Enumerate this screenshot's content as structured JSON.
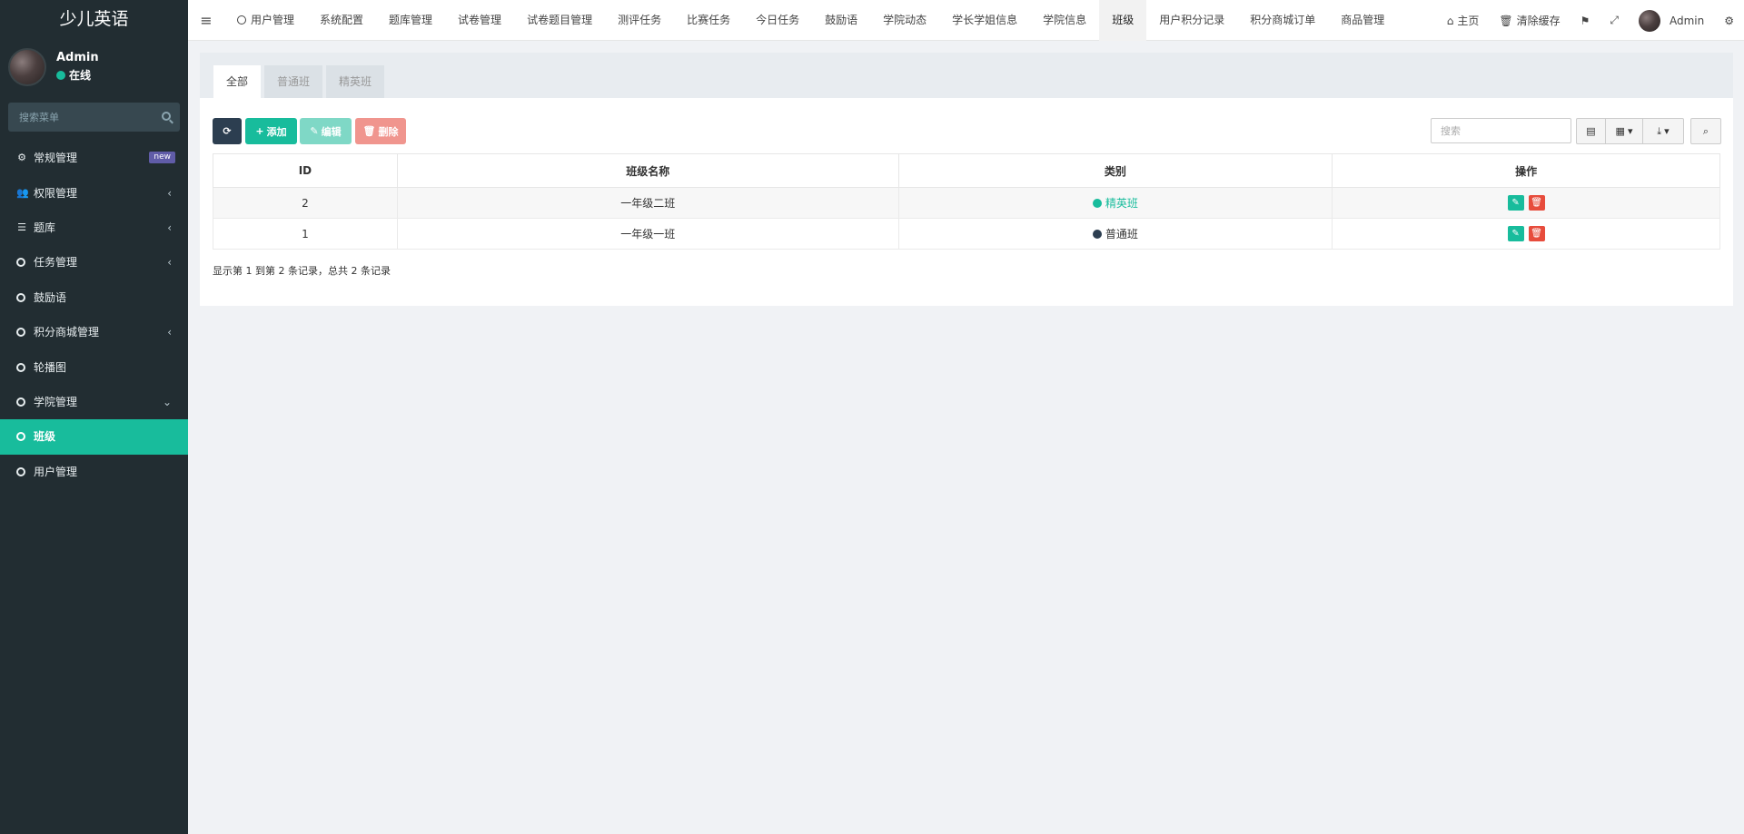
{
  "sidebar": {
    "brand": "少儿英语",
    "user": {
      "name": "Admin",
      "status": "在线"
    },
    "search_placeholder": "搜索菜单",
    "items": [
      {
        "label": "常规管理",
        "icon": "cogs-icon",
        "badge": "new"
      },
      {
        "label": "权限管理",
        "icon": "users-icon",
        "arrow": "‹"
      },
      {
        "label": "题库",
        "icon": "list-icon",
        "arrow": "‹"
      },
      {
        "label": "任务管理",
        "icon": "circle-icon",
        "arrow": "‹"
      },
      {
        "label": "鼓励语",
        "icon": "circle-icon"
      },
      {
        "label": "积分商城管理",
        "icon": "circle-icon",
        "arrow": "‹"
      },
      {
        "label": "轮播图",
        "icon": "circle-icon"
      },
      {
        "label": "学院管理",
        "icon": "circle-icon",
        "arrow": "⌄"
      },
      {
        "label": "班级",
        "icon": "circle-icon",
        "active": true
      },
      {
        "label": "用户管理",
        "icon": "circle-icon"
      }
    ]
  },
  "topbar": {
    "tabs": [
      "用户管理",
      "系统配置",
      "题库管理",
      "试卷管理",
      "试卷题目管理",
      "测评任务",
      "比赛任务",
      "今日任务",
      "鼓励语",
      "学院动态",
      "学长学姐信息",
      "学院信息",
      "班级",
      "用户积分记录",
      "积分商城订单",
      "商品管理"
    ],
    "active_tab": "班级",
    "home": "主页",
    "clear_cache": "清除缓存",
    "user": "Admin"
  },
  "panel": {
    "tabs": [
      "全部",
      "普通班",
      "精英班"
    ],
    "active_tab": "全部",
    "buttons": {
      "add": "添加",
      "edit": "编辑",
      "delete": "删除"
    },
    "search_placeholder": "搜索",
    "columns": [
      "ID",
      "班级名称",
      "类别",
      "操作"
    ],
    "rows": [
      {
        "id": "2",
        "name": "一年级二班",
        "category": "精英班",
        "category_color": "#18bc9c"
      },
      {
        "id": "1",
        "name": "一年级一班",
        "category": "普通班",
        "category_color": "#2c3e50"
      }
    ],
    "footer": "显示第 1 到第 2 条记录，总共 2 条记录"
  },
  "colors": {
    "accent": "#18bc9c",
    "sidebar_bg": "#222d32",
    "danger": "#e74c3c",
    "dark": "#2c3e50"
  }
}
